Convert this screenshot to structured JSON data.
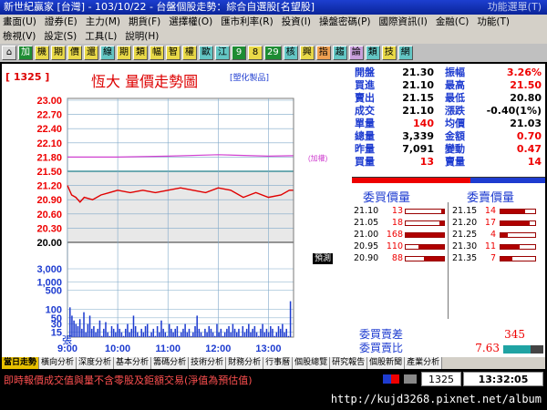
{
  "window": {
    "title": "新世紀贏家 [台灣] - 103/10/22 - 台盤個股走勢：綜合自選股[名望股]",
    "right_text": "功能選單(T)"
  },
  "menu": {
    "row1": [
      "畫面(U)",
      "證券(E)",
      "主力(M)",
      "期貨(F)",
      "選擇權(O)",
      "匯市利率(R)",
      "投資(I)",
      "操盤密碼(P)",
      "國際資訊(I)",
      "金融(C)",
      "功能(T)"
    ],
    "row2": [
      "檢視(V)",
      "設定(S)",
      "工具(L)",
      "說明(H)"
    ]
  },
  "toolbar": [
    "加",
    "機",
    "期",
    "價",
    "還",
    "線",
    "期",
    "類",
    "幅",
    "智",
    "權",
    "歐",
    "江",
    "9",
    "8",
    "29",
    "核",
    "興",
    "指",
    "趨",
    "論",
    "類",
    "技",
    "網"
  ],
  "chart": {
    "code": "[ 1325 ]",
    "title": "恆大  量價走勢圖",
    "tag": "[塑化製品]",
    "ref_label": "(加權)",
    "pred_label": "預測",
    "vol_unit": "張",
    "price_ticks": [
      "23.00",
      "22.70",
      "22.40",
      "22.10",
      "21.80",
      "21.50",
      "21.20",
      "20.90",
      "20.60",
      "20.30",
      "20.00"
    ],
    "vol_ticks": [
      "3,000",
      "1,000",
      "500",
      "100",
      "50",
      "30",
      "15"
    ],
    "time_ticks": [
      "9:00",
      "10:00",
      "11:00",
      "12:00",
      "13:00"
    ]
  },
  "chart_data": {
    "type": "line",
    "title": "恆大  量價走勢圖",
    "series": [
      {
        "name": "price",
        "x": [
          "9:00",
          "9:05",
          "9:10",
          "9:15",
          "9:20",
          "9:30",
          "9:40",
          "9:50",
          "10:00",
          "10:15",
          "10:30",
          "10:45",
          "11:00",
          "11:15",
          "11:30",
          "11:45",
          "12:00",
          "12:15",
          "12:30",
          "12:45",
          "13:00",
          "13:15",
          "13:25",
          "13:30"
        ],
        "values": [
          21.2,
          21.0,
          20.95,
          20.85,
          20.95,
          20.9,
          21.0,
          21.05,
          21.1,
          21.05,
          21.1,
          21.05,
          21.1,
          21.15,
          21.1,
          21.05,
          21.15,
          21.1,
          20.95,
          21.05,
          20.95,
          21.0,
          21.1,
          21.1
        ]
      },
      {
        "name": "(加權)",
        "x": [
          "9:00",
          "10:00",
          "11:00",
          "12:00",
          "13:00",
          "13:30"
        ],
        "values": [
          21.8,
          21.8,
          21.82,
          21.85,
          21.82,
          21.83
        ]
      }
    ],
    "reference_price": 21.5,
    "ylim": [
      20.0,
      23.0
    ],
    "volume": [
      120,
      60,
      40,
      30,
      25,
      45,
      20,
      80,
      15,
      30,
      60,
      20,
      25,
      15,
      20,
      40,
      10,
      20,
      35,
      15,
      10,
      25,
      20,
      15,
      30,
      20,
      15,
      10,
      20,
      30,
      15,
      20,
      60,
      25,
      15,
      10,
      20,
      15,
      25,
      30,
      10,
      15,
      20,
      10,
      25,
      15,
      40,
      20,
      15,
      10,
      30,
      20,
      15,
      20,
      25,
      10,
      15,
      20,
      30,
      15,
      20,
      10,
      15,
      25,
      60,
      20,
      15,
      10,
      20,
      15,
      25,
      20,
      15,
      10,
      30,
      15,
      20,
      10,
      15,
      20,
      25,
      15,
      30,
      20,
      15,
      20,
      10,
      25,
      15,
      20,
      30,
      15,
      20,
      25,
      15,
      10,
      20,
      30,
      15,
      20,
      15,
      25,
      20,
      10,
      15,
      25,
      20,
      30,
      15,
      20,
      10,
      200
    ]
  },
  "quote": {
    "rows": [
      {
        "l1": "開盤",
        "v1": "21.30",
        "l2": "振幅",
        "v2": "3.26%",
        "c2": "red"
      },
      {
        "l1": "買進",
        "v1": "21.10",
        "l2": "最高",
        "v2": "21.50",
        "c2": "red"
      },
      {
        "l1": "賣出",
        "v1": "21.15",
        "l2": "最低",
        "v2": "20.80",
        "c2": "blk"
      },
      {
        "l1": "成交",
        "v1": "21.10",
        "l2": "漲跌",
        "v2": "-0.40(1%)",
        "c2": "blk"
      },
      {
        "l1": "單量",
        "v1": "140",
        "l2": "均價",
        "v2": "21.03",
        "c2": "blk",
        "cv1": "red"
      },
      {
        "l1": "總量",
        "v1": "3,339",
        "l2": "金額",
        "v2": "0.70",
        "c2": "red"
      },
      {
        "l1": "昨量",
        "v1": "7,091",
        "l2": "變動",
        "v2": "0.47",
        "c2": "red"
      },
      {
        "l1": "買量",
        "v1": "13",
        "l2": "賣量",
        "v2": "14",
        "c2": "red",
        "cv1": "red"
      }
    ],
    "bid_header": "委買價量",
    "ask_header": "委賣價量",
    "bids": [
      {
        "price": "21.10",
        "qty": "13",
        "fill": 0.08
      },
      {
        "price": "21.05",
        "qty": "18",
        "fill": 0.11
      },
      {
        "price": "21.00",
        "qty": "168",
        "fill": 1.0
      },
      {
        "price": "20.95",
        "qty": "110",
        "fill": 0.66
      },
      {
        "price": "20.90",
        "qty": "88",
        "fill": 0.52
      }
    ],
    "asks": [
      {
        "price": "21.15",
        "qty": "14",
        "fill": 0.7
      },
      {
        "price": "21.20",
        "qty": "17",
        "fill": 0.85
      },
      {
        "price": "21.25",
        "qty": "4",
        "fill": 0.2
      },
      {
        "price": "21.30",
        "qty": "11",
        "fill": 0.55
      },
      {
        "price": "21.35",
        "qty": "7",
        "fill": 0.35
      }
    ],
    "diff_label": "委買賣差",
    "diff_value": "345",
    "ratio_label": "委買賣比",
    "ratio_value": "7.63"
  },
  "tabs": [
    "當日走勢",
    "橫向分析",
    "深度分析",
    "基本分析",
    "籌碼分析",
    "技術分析",
    "財務分析",
    "行事曆",
    "個股總覽",
    "研究報告",
    "個股新聞",
    "產業分析"
  ],
  "status": {
    "marquee": "即時報價成交值與量不含零股及鉅額交易(淨值為預估值)",
    "code": "1325",
    "time": "13:32:05"
  },
  "url": "http://kujd3268.pixnet.net/album",
  "colors": {
    "price_line": "#e00000",
    "volume_bar": "#1e3cd0",
    "ref_line": "#d040d0",
    "grid": "#7fa8c8",
    "accent_red": "#e00000",
    "accent_blue": "#1e3cd0"
  }
}
